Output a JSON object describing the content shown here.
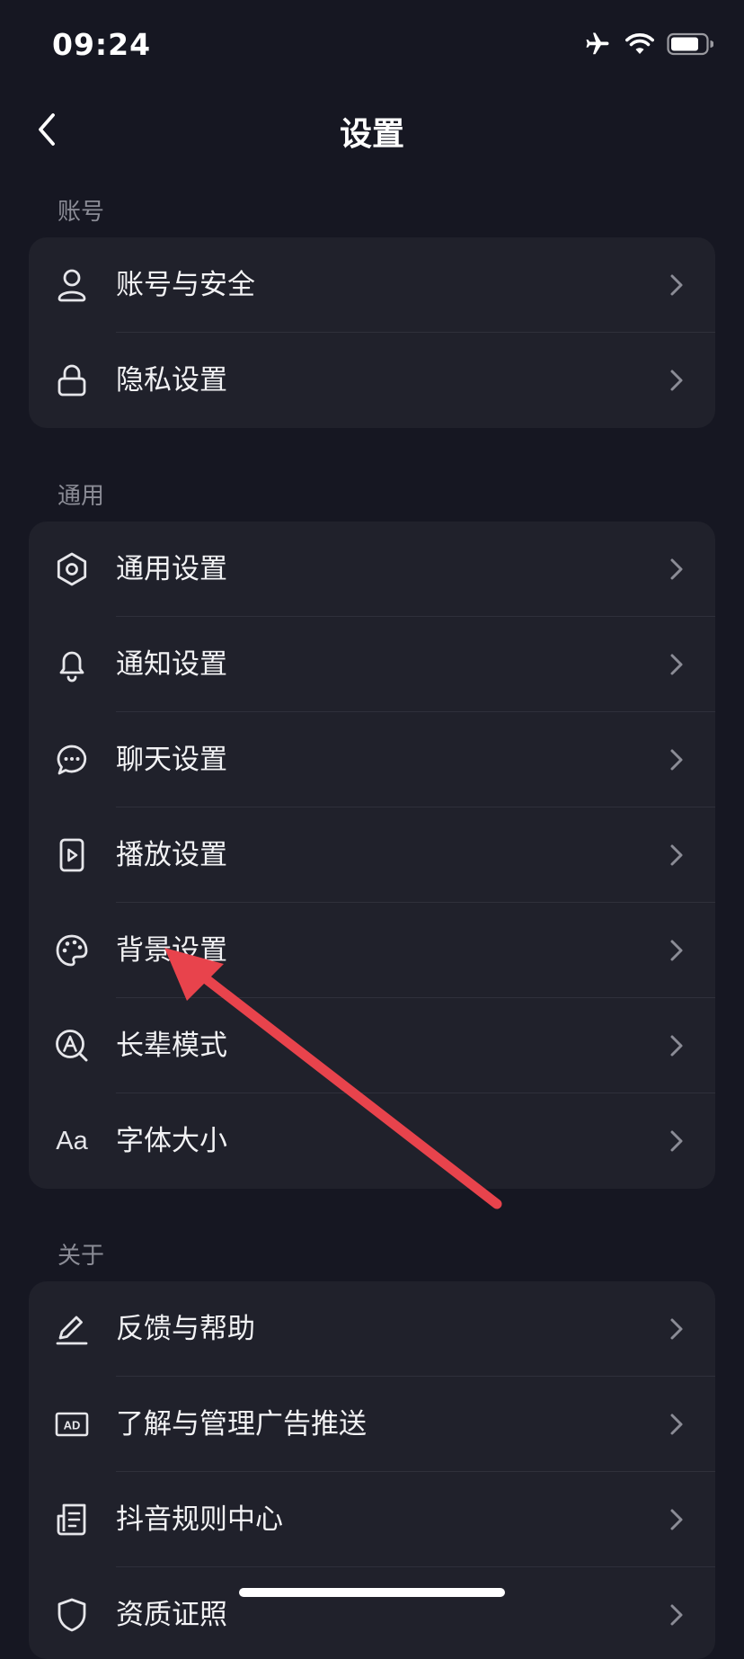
{
  "status_bar": {
    "time": "09:24",
    "icons": [
      "airplane-icon",
      "wifi-icon",
      "battery-icon"
    ]
  },
  "nav": {
    "title": "设置",
    "back_icon": "chevron-left-icon"
  },
  "sections": [
    {
      "label": "账号",
      "items": [
        {
          "icon": "user-icon",
          "label": "账号与安全"
        },
        {
          "icon": "lock-icon",
          "label": "隐私设置"
        }
      ]
    },
    {
      "label": "通用",
      "items": [
        {
          "icon": "gear-icon",
          "label": "通用设置"
        },
        {
          "icon": "bell-icon",
          "label": "通知设置"
        },
        {
          "icon": "chat-bubble-icon",
          "label": "聊天设置"
        },
        {
          "icon": "play-icon",
          "label": "播放设置"
        },
        {
          "icon": "palette-icon",
          "label": "背景设置"
        },
        {
          "icon": "elder-mode-icon",
          "label": "长辈模式"
        },
        {
          "icon": "font-size-icon",
          "icon_text": "Aa",
          "label": "字体大小"
        }
      ]
    },
    {
      "label": "关于",
      "items": [
        {
          "icon": "edit-icon",
          "label": "反馈与帮助"
        },
        {
          "icon": "ad-icon",
          "icon_text": "AD",
          "label": "了解与管理广告推送"
        },
        {
          "icon": "document-icon",
          "label": "抖音规则中心"
        },
        {
          "icon": "shield-icon",
          "label": "资质证照"
        }
      ]
    }
  ],
  "colors": {
    "background": "#161722",
    "card": "#20212b",
    "divider": "#2f303b",
    "section_label": "#8b8c96",
    "arrow": "#e8434c"
  }
}
